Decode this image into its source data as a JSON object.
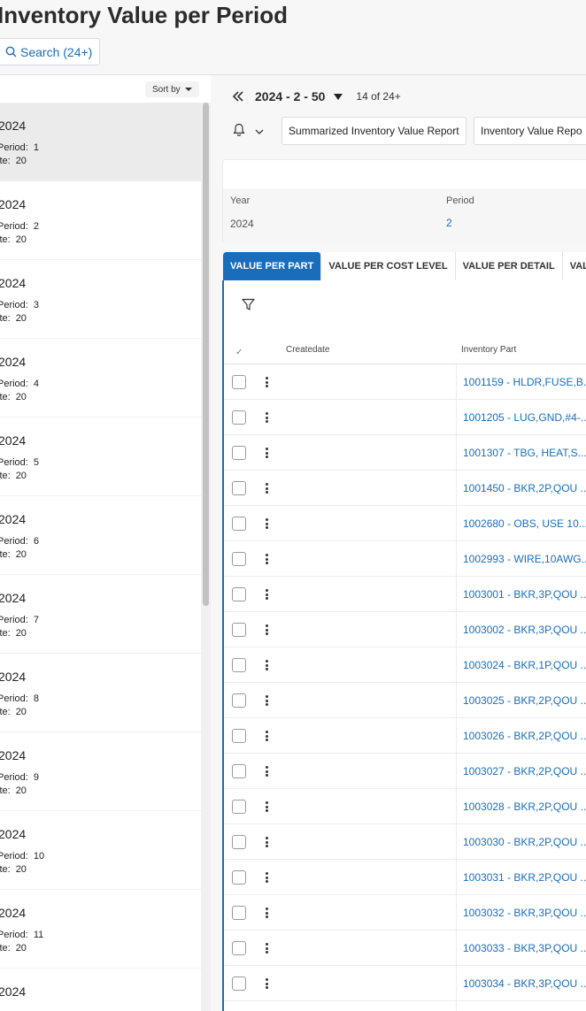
{
  "page": {
    "title": "Inventory Value per Period"
  },
  "search": {
    "label": "Search (24+)"
  },
  "sort": {
    "label": "Sort by"
  },
  "list": {
    "items": [
      {
        "year": "2024",
        "period_label": "Period:",
        "period": "1",
        "site_label": "ite:",
        "site": "20",
        "selected": true
      },
      {
        "year": "2024",
        "period_label": "Period:",
        "period": "2",
        "site_label": "ite:",
        "site": "20"
      },
      {
        "year": "2024",
        "period_label": "Period:",
        "period": "3",
        "site_label": "ite:",
        "site": "20"
      },
      {
        "year": "2024",
        "period_label": "Period:",
        "period": "4",
        "site_label": "ite:",
        "site": "20"
      },
      {
        "year": "2024",
        "period_label": "Period:",
        "period": "5",
        "site_label": "ite:",
        "site": "20"
      },
      {
        "year": "2024",
        "period_label": "Period:",
        "period": "6",
        "site_label": "ite:",
        "site": "20"
      },
      {
        "year": "2024",
        "period_label": "Period:",
        "period": "7",
        "site_label": "ite:",
        "site": "20"
      },
      {
        "year": "2024",
        "period_label": "Period:",
        "period": "8",
        "site_label": "ite:",
        "site": "20"
      },
      {
        "year": "2024",
        "period_label": "Period:",
        "period": "9",
        "site_label": "ite:",
        "site": "20"
      },
      {
        "year": "2024",
        "period_label": "Period:",
        "period": "10",
        "site_label": "ite:",
        "site": "20"
      },
      {
        "year": "2024",
        "period_label": "Period:",
        "period": "11",
        "site_label": "ite:",
        "site": "20"
      },
      {
        "year": "2024",
        "period_label": "",
        "period": "",
        "site_label": "",
        "site": ""
      }
    ]
  },
  "record": {
    "label": "2024 - 2 - 50",
    "count": "14 of 24+"
  },
  "reports": {
    "summarized": "Summarized Inventory Value Report",
    "inventory": "Inventory Value Repo"
  },
  "details": {
    "year_label": "Year",
    "year_value": "2024",
    "period_label": "Period",
    "period_value": "2"
  },
  "tabs": [
    "VALUE PER PART",
    "VALUE PER COST LEVEL",
    "VALUE PER DETAIL",
    "VALUE P"
  ],
  "grid": {
    "check_header": "✓",
    "columns": {
      "createdate": "Createdate",
      "inventory_part": "Inventory Part"
    },
    "rows": [
      "1001159 - HLDR,FUSE,B...",
      "1001205 - LUG,GND,#4-...",
      "1001307 - TBG, HEAT,S...",
      "1001450 - BKR,2P,QOU ...",
      "1002680 - OBS, USE 10...",
      "1002993 - WIRE,10AWG...",
      "1003001 - BKR,3P,QOU ...",
      "1003002 - BKR,3P,QOU ...",
      "1003024 - BKR,1P,QOU ...",
      "1003025 - BKR,2P,QOU ...",
      "1003026 - BKR,2P,QOU ...",
      "1003027 - BKR,2P,QOU ...",
      "1003028 - BKR,2P,QOU ...",
      "1003030 - BKR,2P,QOU ...",
      "1003031 - BKR,2P,QOU ...",
      "1003032 - BKR,3P,QOU ...",
      "1003033 - BKR,3P,QOU ...",
      "1003034 - BKR,3P,QOU ...",
      ""
    ]
  },
  "colors": {
    "accent": "#1a6dbb",
    "selected_row": "#ebebeb"
  }
}
